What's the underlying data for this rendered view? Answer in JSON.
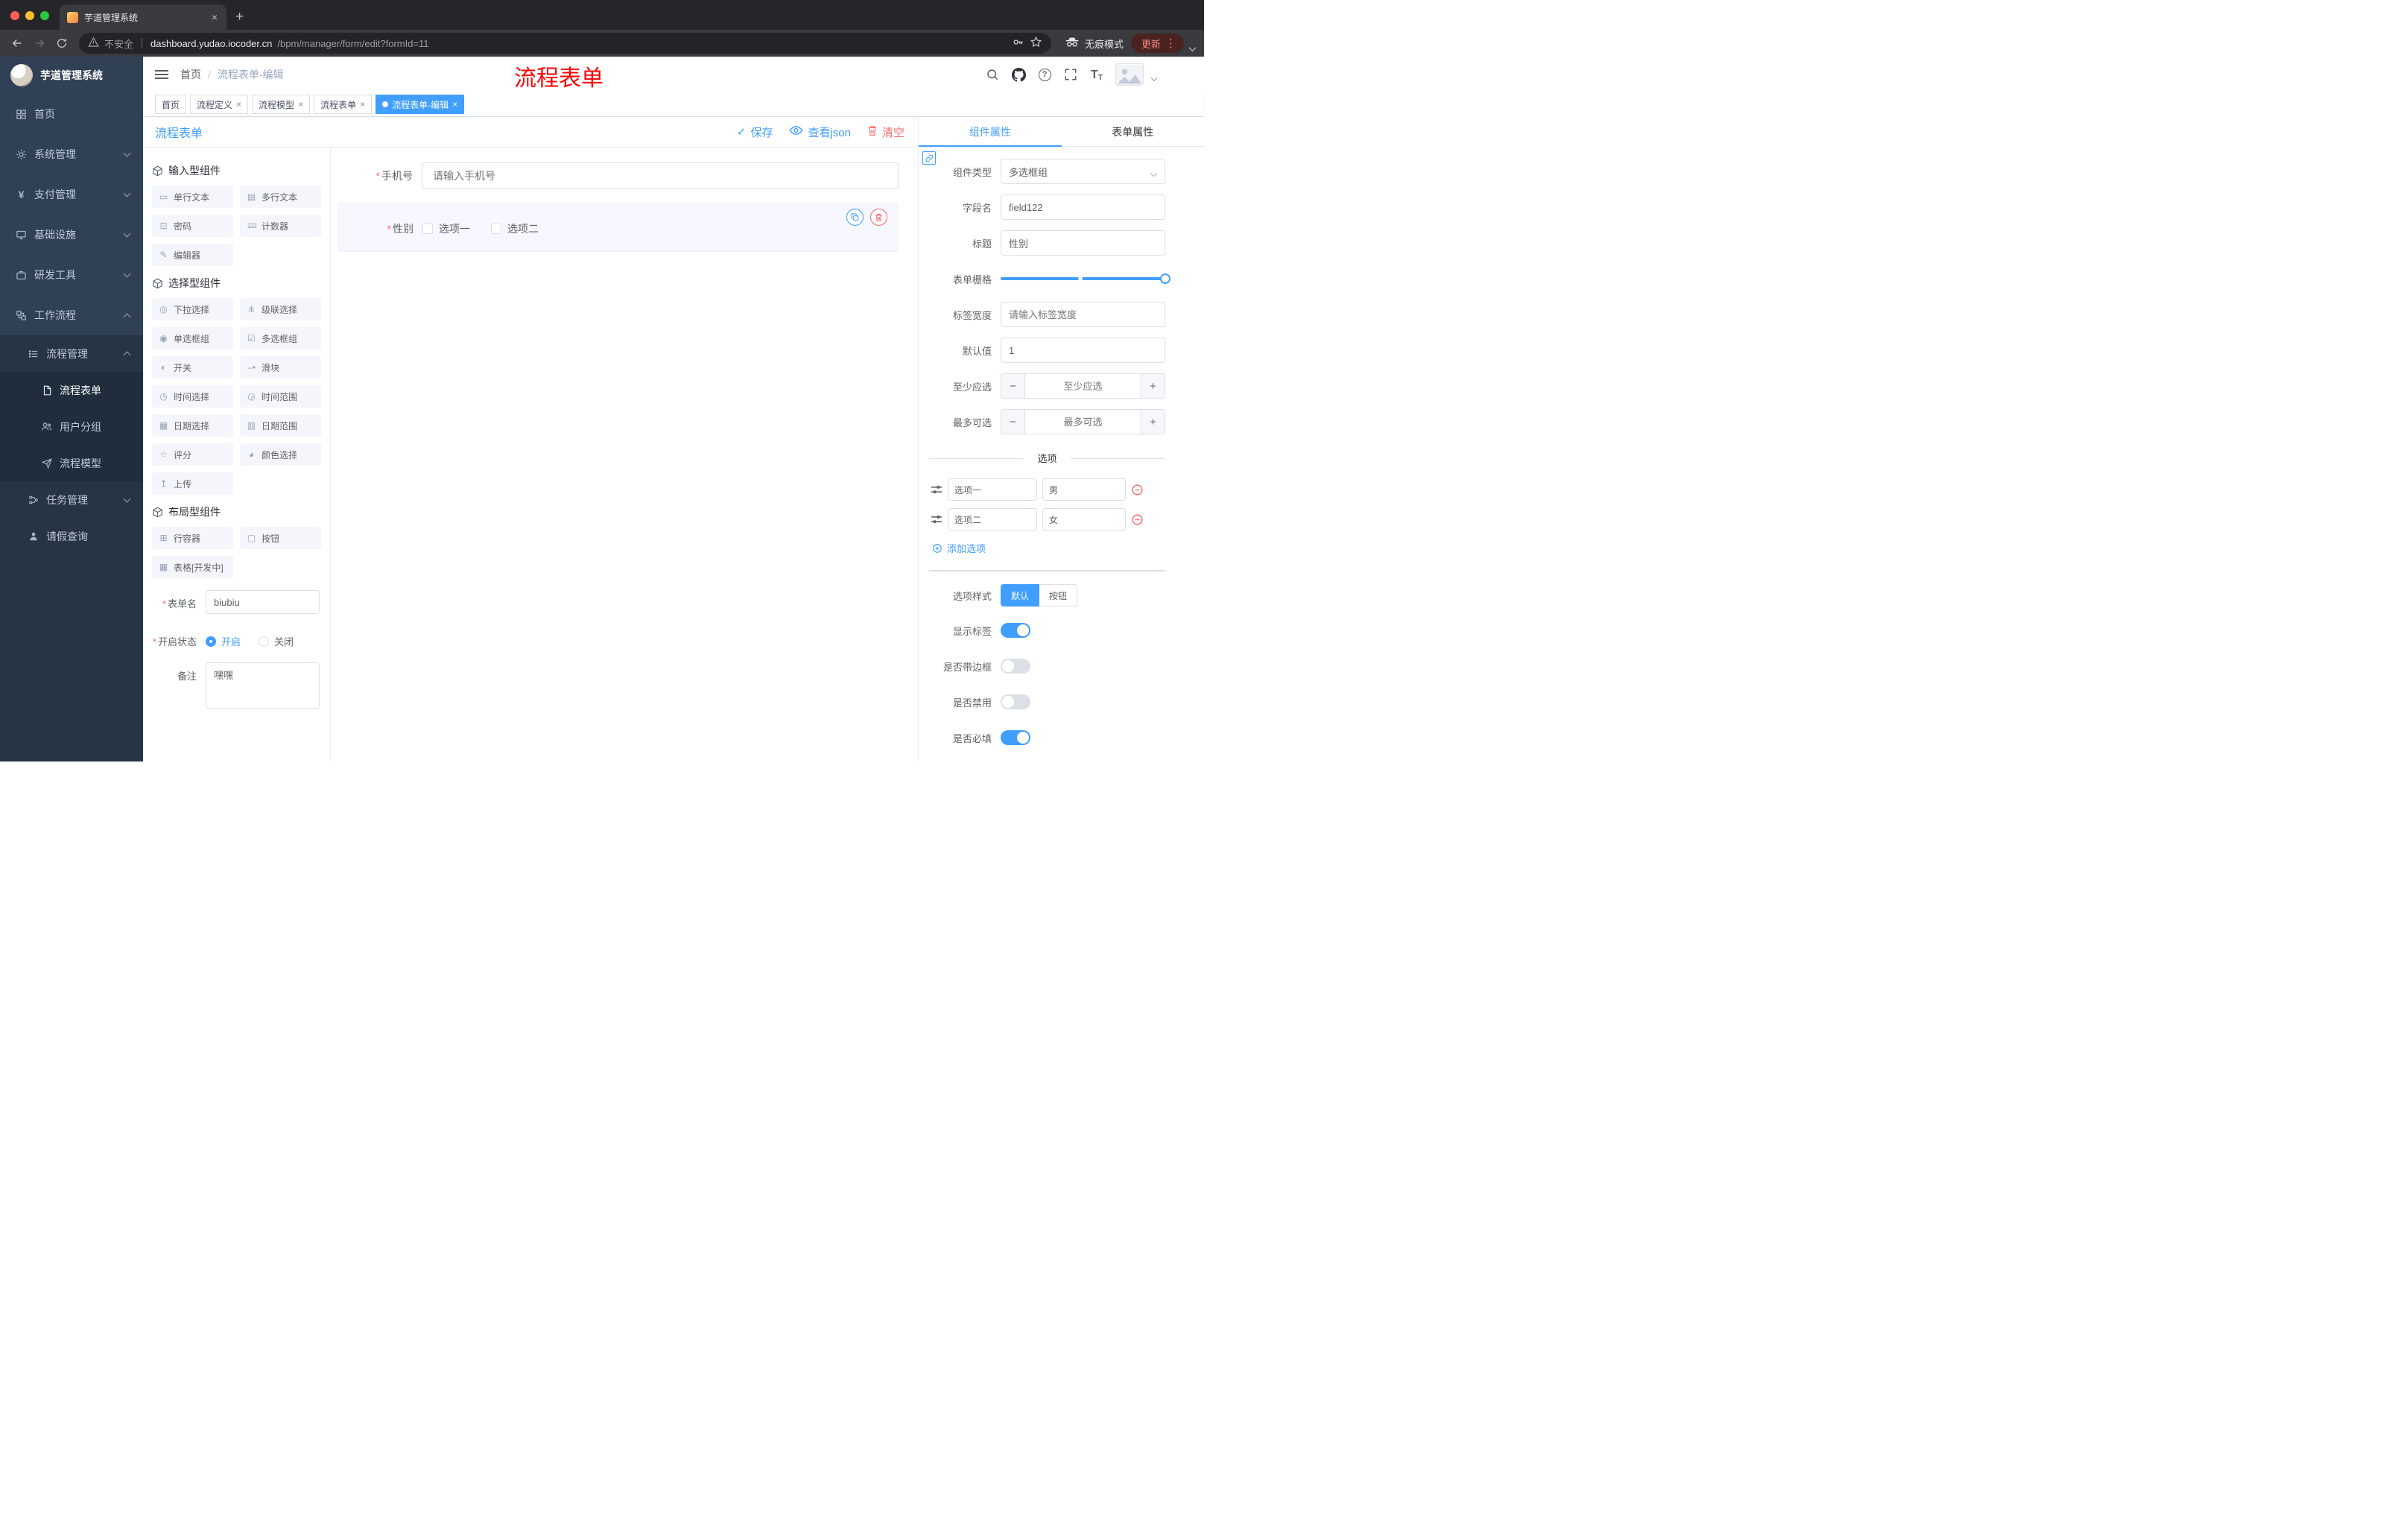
{
  "colors": {
    "accent": "#409eff",
    "danger": "#f56c6c",
    "sidebar_bg": "#304156"
  },
  "browser": {
    "tab_title": "芋道管理系统",
    "security_label": "不安全",
    "url_host": "dashboard.yudao.iocoder.cn",
    "url_path": "/bpm/manager/form/edit?formId=11",
    "incognito_label": "无痕模式",
    "update_label": "更新"
  },
  "sidebar": {
    "logo_title": "芋道管理系统",
    "home": "首页",
    "system": "系统管理",
    "payment": "支付管理",
    "infra": "基础设施",
    "devtools": "研发工具",
    "workflow": "工作流程",
    "process_mgmt": "流程管理",
    "process_form": "流程表单",
    "user_group": "用户分组",
    "process_model": "流程模型",
    "task_mgmt": "任务管理",
    "leave_query": "请假查询"
  },
  "header": {
    "breadcrumb_home": "首页",
    "breadcrumb_current": "流程表单-编辑",
    "watermark": "流程表单"
  },
  "tags": {
    "items": [
      {
        "label": "首页",
        "closable": false,
        "active": false
      },
      {
        "label": "流程定义",
        "closable": true,
        "active": false
      },
      {
        "label": "流程模型",
        "closable": true,
        "active": false
      },
      {
        "label": "流程表单",
        "closable": true,
        "active": false
      },
      {
        "label": "流程表单-编辑",
        "closable": true,
        "active": true
      }
    ]
  },
  "editor": {
    "title": "流程表单",
    "save": "保存",
    "view_json": "查看json",
    "clear": "清空"
  },
  "palette": {
    "sections": [
      {
        "title": "输入型组件",
        "items": [
          {
            "label": "单行文本",
            "icon": "single-line-text-icon"
          },
          {
            "label": "多行文本",
            "icon": "multi-line-text-icon"
          },
          {
            "label": "密码",
            "icon": "password-icon"
          },
          {
            "label": "计数器",
            "icon": "counter-icon"
          },
          {
            "label": "编辑器",
            "icon": "editor-icon"
          }
        ]
      },
      {
        "title": "选择型组件",
        "items": [
          {
            "label": "下拉选择",
            "icon": "select-icon"
          },
          {
            "label": "级联选择",
            "icon": "cascader-icon"
          },
          {
            "label": "单选框组",
            "icon": "radio-group-icon"
          },
          {
            "label": "多选框组",
            "icon": "checkbox-group-icon"
          },
          {
            "label": "开关",
            "icon": "switch-icon"
          },
          {
            "label": "滑块",
            "icon": "slider-icon"
          },
          {
            "label": "时间选择",
            "icon": "time-picker-icon"
          },
          {
            "label": "时间范围",
            "icon": "time-range-icon"
          },
          {
            "label": "日期选择",
            "icon": "date-picker-icon"
          },
          {
            "label": "日期范围",
            "icon": "date-range-icon"
          },
          {
            "label": "评分",
            "icon": "rate-icon"
          },
          {
            "label": "颜色选择",
            "icon": "color-picker-icon"
          },
          {
            "label": "上传",
            "icon": "upload-icon"
          }
        ]
      },
      {
        "title": "布局型组件",
        "items": [
          {
            "label": "行容器",
            "icon": "row-container-icon"
          },
          {
            "label": "按钮",
            "icon": "button-icon"
          },
          {
            "label": "表格[开发中]",
            "icon": "table-icon"
          }
        ]
      }
    ],
    "form": {
      "name_label": "表单名",
      "name_value": "biubiu",
      "status_label": "开启状态",
      "status_on": "开启",
      "status_off": "关闭",
      "status_selected": "开启",
      "remark_label": "备注",
      "remark_value": "嘿嘿"
    }
  },
  "canvas": {
    "phone": {
      "label": "手机号",
      "required": true,
      "placeholder": "请输入手机号"
    },
    "gender": {
      "label": "性别",
      "required": true,
      "option_1": "选项一",
      "option_2": "选项二",
      "selected": true
    }
  },
  "props": {
    "tab_component": "组件属性",
    "tab_form": "表单属性",
    "active_tab": "组件属性",
    "component_type": {
      "label": "组件类型",
      "value": "多选框组"
    },
    "field_name": {
      "label": "字段名",
      "value": "field122"
    },
    "title": {
      "label": "标题",
      "value": "性别"
    },
    "form_grid": {
      "label": "表单栅格"
    },
    "label_width": {
      "label": "标签宽度",
      "placeholder": "请输入标签宽度"
    },
    "default_value": {
      "label": "默认值",
      "value": "1"
    },
    "min_select": {
      "label": "至少应选",
      "placeholder": "至少应选"
    },
    "max_select": {
      "label": "最多可选",
      "placeholder": "最多可选"
    },
    "options": {
      "divider_title": "选项",
      "items": [
        {
          "label": "选项一",
          "value": "男"
        },
        {
          "label": "选项二",
          "value": "女"
        }
      ],
      "add_label": "添加选项"
    },
    "option_style": {
      "label": "选项样式",
      "opt_default": "默认",
      "opt_button": "按钮",
      "selected": "默认"
    },
    "switches": [
      {
        "label": "显示标签",
        "on": true
      },
      {
        "label": "是否带边框",
        "on": false
      },
      {
        "label": "是否禁用",
        "on": false
      },
      {
        "label": "是否必填",
        "on": true
      }
    ]
  }
}
